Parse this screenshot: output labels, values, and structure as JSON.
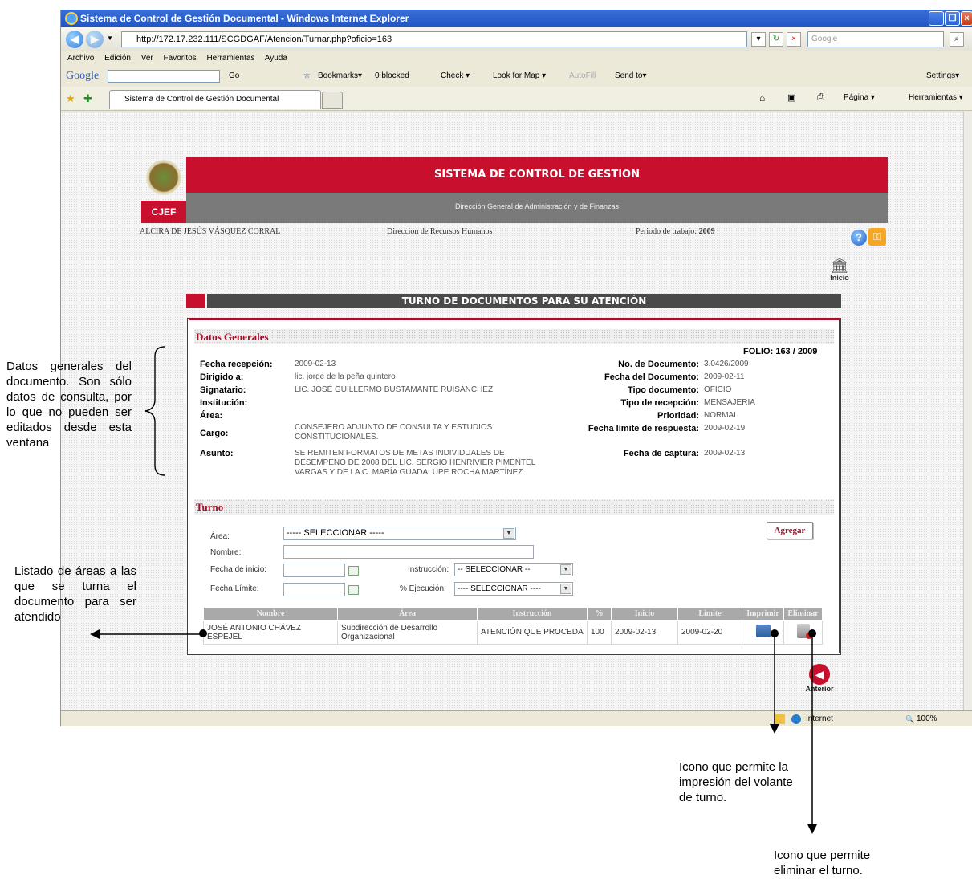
{
  "browser": {
    "window_title": "Sistema de Control de Gestión Documental - Windows Internet Explorer",
    "url": "http://172.17.232.111/SCGDGAF/Atencion/Turnar.php?oficio=163",
    "search_placeholder": "Google",
    "menu": [
      "Archivo",
      "Edición",
      "Ver",
      "Favoritos",
      "Herramientas",
      "Ayuda"
    ],
    "google_toolbar": {
      "logo": "Google",
      "go": "Go",
      "bookmarks": "Bookmarks▾",
      "blocked": "0 blocked",
      "check": "Check ▾",
      "lookformap": "Look for Map ▾",
      "autofill": "AutoFill",
      "sendto": "Send to▾",
      "settings": "Settings▾"
    },
    "tab_title": "Sistema de Control de Gestión Documental",
    "command_bar": {
      "pagina": "Página ▾",
      "herramientas": "Herramientas ▾"
    },
    "status": {
      "zone": "Internet",
      "zoom": "100%"
    }
  },
  "header": {
    "system_title": "SISTEMA DE CONTROL DE GESTION",
    "subtitle": "Dirección General de Administración y de Finanzas",
    "logo_text": "CJEF",
    "user_name": "ALCIRA DE JESÚS VÁSQUEZ CORRAL",
    "department": "Direccion de Recursos Humanos",
    "period_label": "Periodo de trabajo:",
    "period_value": "2009",
    "inicio_label": "Inicio"
  },
  "page_title": "TURNO DE DOCUMENTOS PARA SU ATENCIÓN",
  "datos_generales": {
    "heading": "Datos Generales",
    "folio": "FOLIO: 163 / 2009",
    "left": [
      {
        "label": "Fecha recepción:",
        "value": "2009-02-13"
      },
      {
        "label": "Dirigido a:",
        "value": "lic. jorge de la peña quintero"
      },
      {
        "label": "Signatario:",
        "value": "LIC. JOSÉ GUILLERMO BUSTAMANTE RUISÁNCHEZ"
      },
      {
        "label": "Institución:",
        "value": ""
      },
      {
        "label": "Área:",
        "value": ""
      },
      {
        "label": "Cargo:",
        "value": "CONSEJERO ADJUNTO DE CONSULTA Y ESTUDIOS CONSTITUCIONALES."
      },
      {
        "label": "Asunto:",
        "value": "SE REMITEN FORMATOS DE METAS INDIVIDUALES DE DESEMPEÑO DE 2008 DEL LIC. SERGIO HENRIVIER PIMENTEL VARGAS Y DE LA C. MARÍA GUADALUPE ROCHA MARTÍNEZ"
      }
    ],
    "right": [
      {
        "label": "No. de Documento:",
        "value": "3.0426/2009"
      },
      {
        "label": "Fecha del Documento:",
        "value": "2009-02-11"
      },
      {
        "label": "Tipo documento:",
        "value": "OFICIO"
      },
      {
        "label": "Tipo de recepción:",
        "value": "MENSAJERIA"
      },
      {
        "label": "Prioridad:",
        "value": "NORMAL"
      },
      {
        "label": "Fecha límite de respuesta:",
        "value": "2009-02-19"
      },
      {
        "label": "Fecha de captura:",
        "value": "2009-02-13"
      }
    ]
  },
  "turno": {
    "heading": "Turno",
    "area_label": "Área:",
    "area_value": "----- SELECCIONAR -----",
    "nombre_label": "Nombre:",
    "nombre_value": "",
    "fecha_inicio_label": "Fecha de inicio:",
    "fecha_limite_label": "Fecha Límite:",
    "instruccion_label": "Instrucción:",
    "instruccion_value": "-- SELECCIONAR --",
    "ejecucion_label": "% Ejecución:",
    "ejecucion_value": "---- SELECCIONAR ----",
    "agregar_label": "Agregar",
    "columns": [
      "Nombre",
      "Área",
      "Instrucción",
      "%",
      "Inicio",
      "Límite",
      "Imprimir",
      "Eliminar"
    ],
    "rows": [
      {
        "nombre": "JOSÉ ANTONIO CHÁVEZ ESPEJEL",
        "area": "Subdirección de Desarrollo Organizacional",
        "instruccion": "ATENCIÓN QUE PROCEDA",
        "porcentaje": "100",
        "inicio": "2009-02-13",
        "limite": "2009-02-20"
      }
    ]
  },
  "anterior_label": "Anterior",
  "annotations": {
    "datos_generales": "Datos generales del documento. Son sólo datos de consulta, por lo que no pueden ser editados desde esta ventana",
    "listado": "Listado de áreas a las que se turna el documento para ser atendido",
    "imprimir": "Icono que permite la impresión del volante de turno.",
    "eliminar": "Icono que permite eliminar el turno."
  }
}
